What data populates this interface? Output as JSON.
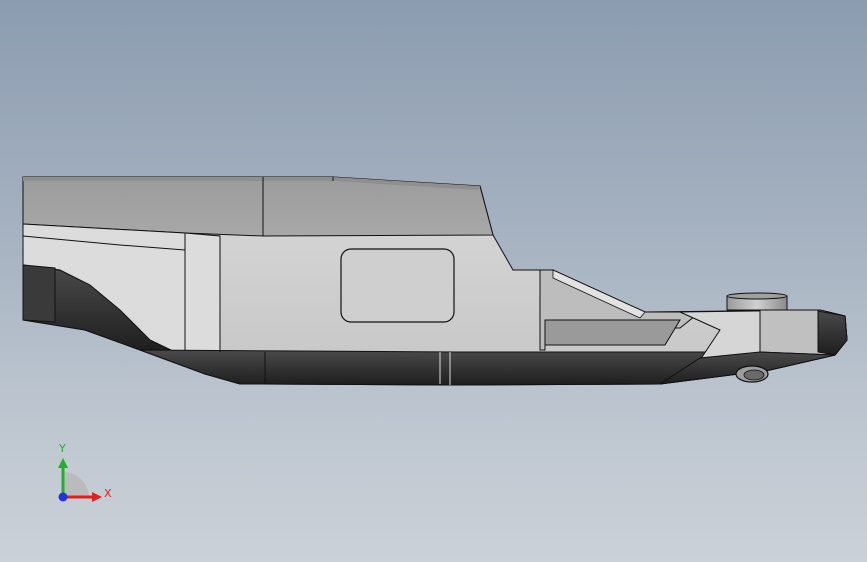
{
  "triad": {
    "x_label": "X",
    "y_label": "Y",
    "x_color": "#e0201c",
    "y_color": "#22b02a",
    "z_color": "#2233dd"
  },
  "model": {
    "light_face": "#d3d3d3",
    "mid_face": "#a5a5a5",
    "dark_face": "#2e2e2e",
    "edge": "#111111"
  }
}
